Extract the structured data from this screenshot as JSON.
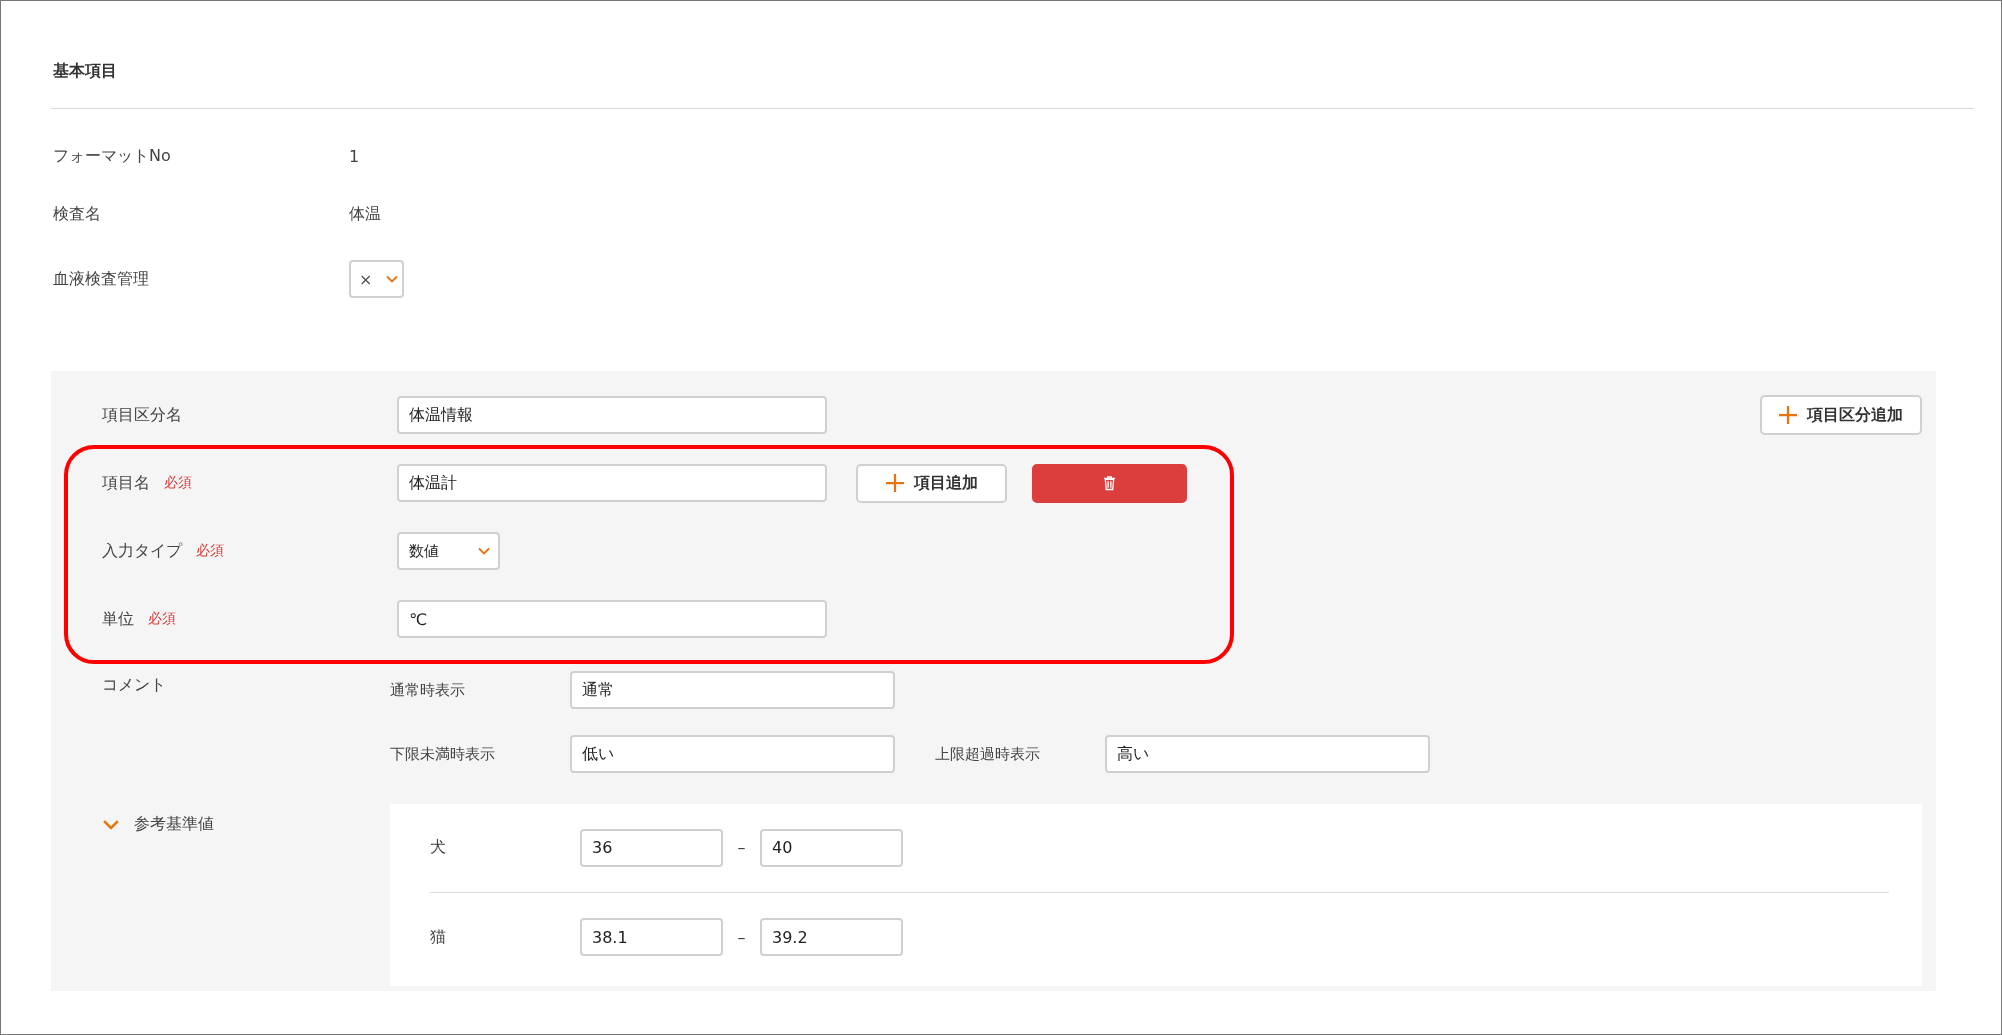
{
  "section_title": "基本項目",
  "info_rows": [
    {
      "kind": "text",
      "label": "フォーマットNo",
      "value": "1"
    },
    {
      "kind": "text",
      "label": "検査名",
      "value": "体温"
    },
    {
      "kind": "select",
      "label": "血液検査管理",
      "value": "×"
    }
  ],
  "category": {
    "label": "項目区分名",
    "value": "体温情報",
    "add_button": "項目区分追加"
  },
  "item_group": {
    "highlighted": true,
    "add_button": "項目追加",
    "fields": [
      {
        "kind": "text",
        "label": "項目名",
        "required": "必須",
        "value": "体温計"
      },
      {
        "kind": "select",
        "label": "入力タイプ",
        "required": "必須",
        "value": "数値"
      },
      {
        "kind": "text",
        "label": "単位",
        "required": "必須",
        "value": "℃"
      }
    ]
  },
  "comment": {
    "label": "コメント",
    "fields": [
      {
        "label": "通常時表示",
        "value": "通常"
      },
      {
        "label": "下限未満時表示",
        "value": "低い"
      },
      {
        "label": "上限超過時表示",
        "value": "高い"
      }
    ]
  },
  "reference": {
    "label": "参考基準値",
    "expanded": true,
    "rows": [
      {
        "species": "犬",
        "min": "36",
        "dash": "–",
        "max": "40"
      },
      {
        "species": "猫",
        "min": "38.1",
        "dash": "–",
        "max": "39.2"
      }
    ]
  }
}
